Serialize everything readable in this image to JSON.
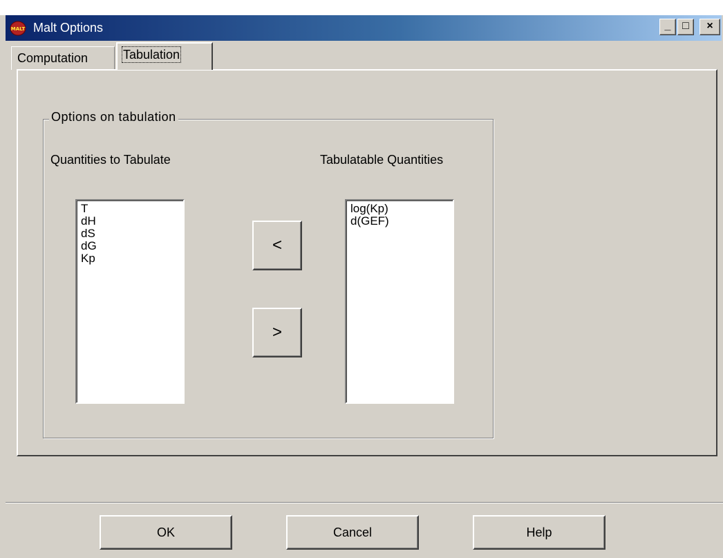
{
  "window": {
    "title": "Malt Options",
    "icon_text": "MALT",
    "controls": {
      "minimize": "_",
      "maximize": "□",
      "close": "×"
    }
  },
  "tabs": [
    {
      "label": "Computation",
      "active": false
    },
    {
      "label": "Tabulation",
      "active": true
    }
  ],
  "group": {
    "legend": "Options on tabulation",
    "left_label": "Quantities to Tabulate",
    "right_label": "Tabulatable Quantities",
    "left_items": [
      "T",
      "dH",
      "dS",
      "dG",
      "Kp"
    ],
    "right_items": [
      "log(Kp)",
      "d(GEF)"
    ],
    "move_left_label": "<",
    "move_right_label": ">"
  },
  "footer": {
    "ok_label": "OK",
    "cancel_label": "Cancel",
    "help_label": "Help"
  }
}
